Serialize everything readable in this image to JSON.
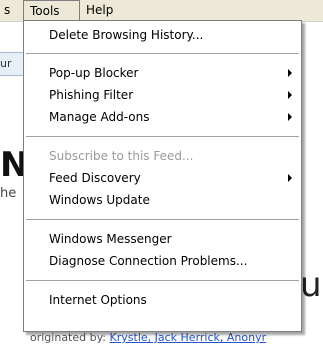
{
  "menubar": {
    "partial_item": "s",
    "tools_label": "Tools",
    "help_label": "Help"
  },
  "background": {
    "strip_text": "ur",
    "big_letter": "N",
    "fragment_he": "he",
    "big_fragment_right": "u",
    "footer_prefix": "originated by:",
    "footer_links": "Krystle, Jack Herrick, Anonyr"
  },
  "tools_menu": {
    "delete_history": "Delete Browsing History...",
    "popup_blocker": "Pop-up Blocker",
    "phishing_filter": "Phishing Filter",
    "manage_addons": "Manage Add-ons",
    "subscribe_feed": "Subscribe to this Feed...",
    "feed_discovery": "Feed Discovery",
    "windows_update": "Windows Update",
    "windows_messenger": "Windows Messenger",
    "diagnose_connection": "Diagnose Connection Problems...",
    "internet_options": "Internet Options"
  }
}
